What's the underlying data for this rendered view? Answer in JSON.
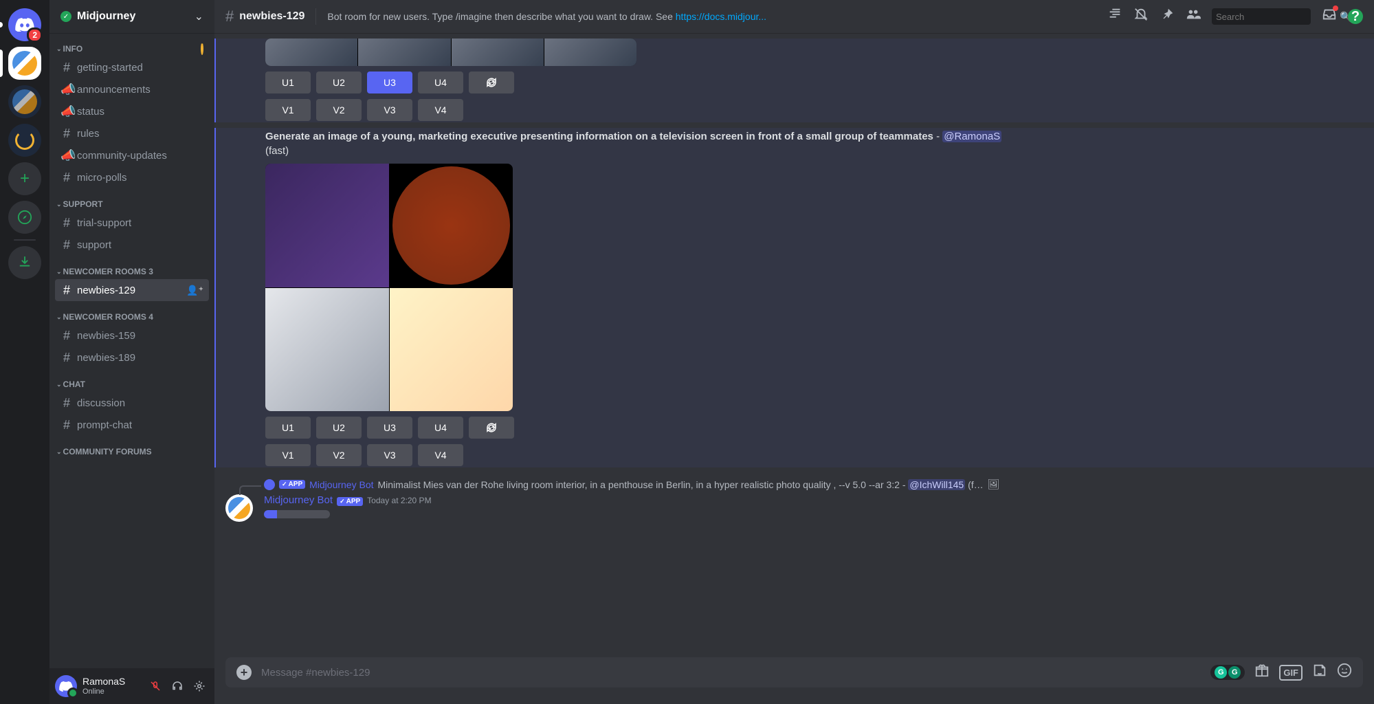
{
  "server": {
    "name": "Midjourney",
    "dm_badge": "2"
  },
  "header": {
    "channel": "newbies-129",
    "topic_prefix": "Bot room for new users. Type /imagine then describe what you want to draw. See ",
    "topic_link": "https://docs.midjour...",
    "search_placeholder": "Search"
  },
  "categories": {
    "info": "INFO",
    "support": "SUPPORT",
    "newcomer3": "NEWCOMER ROOMS 3",
    "newcomer4": "NEWCOMER ROOMS 4",
    "chat": "CHAT",
    "forums": "COMMUNITY FORUMS"
  },
  "channels": {
    "getting_started": "getting-started",
    "announcements": "announcements",
    "status": "status",
    "rules": "rules",
    "community_updates": "community-updates",
    "micro_polls": "micro-polls",
    "trial_support": "trial-support",
    "support": "support",
    "newbies_129": "newbies-129",
    "newbies_159": "newbies-159",
    "newbies_189": "newbies-189",
    "discussion": "discussion",
    "prompt_chat": "prompt-chat"
  },
  "user": {
    "name": "RamonaS",
    "status": "Online"
  },
  "msg1": {
    "u1": "U1",
    "u2": "U2",
    "u3": "U3",
    "u4": "U4",
    "v1": "V1",
    "v2": "V2",
    "v3": "V3",
    "v4": "V4"
  },
  "msg2": {
    "prompt": "Generate an image of a young, marketing executive presenting information on a television screen in front of a small group of teammates",
    "dash": " - ",
    "mention": "@RamonaS",
    "suffix": "(fast)",
    "u1": "U1",
    "u2": "U2",
    "u3": "U3",
    "u4": "U4",
    "v1": "V1",
    "v2": "V2",
    "v3": "V3",
    "v4": "V4"
  },
  "reply": {
    "app_tag": "APP",
    "author": "Midjourney Bot",
    "text": "Minimalist Mies van der Rohe living room interior, in a penthouse in Berlin, in a hyper realistic photo quality , --v 5.0 --ar 3:2 - ",
    "mention": "@IchWill145",
    "tail": " (f…"
  },
  "msg3": {
    "author": "Midjourney Bot",
    "app_tag": "APP",
    "time": "Today at 2:20 PM"
  },
  "input": {
    "placeholder": "Message #newbies-129",
    "gif": "GIF"
  }
}
